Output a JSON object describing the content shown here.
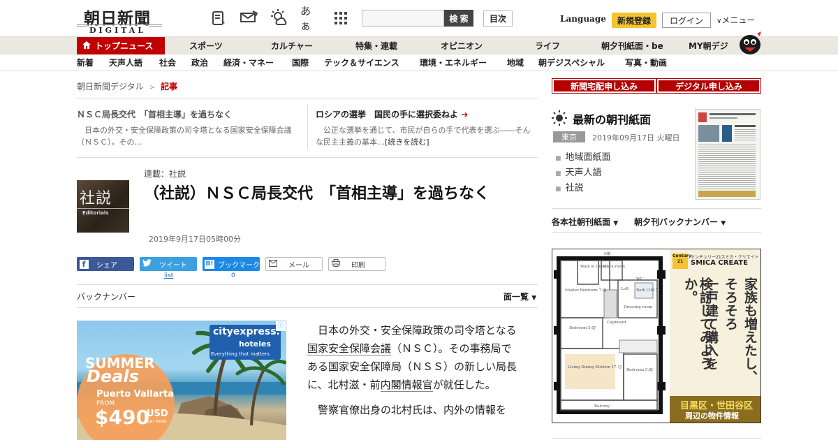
{
  "header": {
    "logo_kanji": "朝日新聞",
    "logo_sub": "DIGITAL",
    "icons": [
      "scrap-icon",
      "message-icon",
      "weather-icon",
      "font-size-icon",
      "grid-menu-icon"
    ],
    "font_size_label": "あぁ",
    "search_placeholder": "",
    "search_button": "検 索",
    "toc_button": "目次",
    "language": "Language",
    "signup": "新規登録",
    "login": "ログイン",
    "menu": "メニュー"
  },
  "nav_primary": [
    "トップニュース",
    "スポーツ",
    "カルチャー",
    "特集・連載",
    "オピニオン",
    "ライフ",
    "朝夕刊紙面・be",
    "MY朝デジ"
  ],
  "nav_secondary": [
    "新着",
    "天声人語",
    "社会",
    "政治",
    "経済・マネー",
    "国際",
    "テック＆サイエンス",
    "環境・エネルギー",
    "地域",
    "朝デジスペシャル",
    "写真・動画"
  ],
  "breadcrumb": {
    "home": "朝日新聞デジタル",
    "sep": ">",
    "current": "記事"
  },
  "teasers": [
    {
      "title": "ＮＳＣ局長交代　「首相主導」を過ちなく",
      "body": "日本の外交・安全保障政策の司令塔となる国家安全保障会議（ＮＳＣ）。その…"
    },
    {
      "title": "ロシアの選挙　国民の手に選択委ねよ",
      "body": "公正な選挙を通じて、市民が自らの手で代表を選ぶ――そんな民主主義の基本…",
      "more": "[続きを読む]"
    }
  ],
  "article": {
    "thumb_kanji": "社説",
    "thumb_en": "Editorials",
    "series": "連載：社説",
    "headline": "（社説）ＮＳＣ局長交代　「首相主導」を過ちなく",
    "date": "2019年9月17日05時00分",
    "share": {
      "facebook": "シェア",
      "twitter": "ツイート",
      "hatena": "ブックマーク",
      "mail": "メール",
      "print": "印刷",
      "twitter_count": "list",
      "hatena_count": "0"
    },
    "back_numbers": "バックナンバー",
    "page_list": "面一覧",
    "body": [
      [
        "日本の外交・安全保障政策の司令塔となる",
        "国家安全保障会議",
        "（ＮＳＣ）。その事務局である国家安全保障局（ＮＳＳ）の新しい局長に、北村滋・前",
        "内閣情報官",
        "が就任した。"
      ],
      [
        "警察官僚出身の北村氏は、内外の情報を"
      ]
    ]
  },
  "ad_left": {
    "brand": "cityexpress.",
    "brand_sub": "hoteles",
    "tagline": "Everything that matters",
    "headline1": "SUMMER",
    "headline2": "Deals",
    "city": "Puerto Vallarta",
    "from": "FROM",
    "price": "$490",
    "currency": "USD",
    "per": "per week"
  },
  "sidebar": {
    "btn_delivery": "新聞宅配申し込み",
    "btn_digital": "デジタル申し込み",
    "paper_title": "最新の朝刊紙面",
    "region": "東京",
    "paper_date": "2019年09月17日 火曜日",
    "links": [
      "地域面紙面",
      "天声人語",
      "社説"
    ],
    "dropdown_regional": "各本社朝刊紙面",
    "dropdown_backnumber": "朝夕刊バックナンバー"
  },
  "ad_right": {
    "brand": "センチュリー21スミカ・クリエイト",
    "brand_en": "SMICA CREATE",
    "logo": "Century 21",
    "copy_col1": "家族も増えたし、",
    "copy_col2": "そろそろ",
    "copy_col3": "一戸建て購入を",
    "copy_col4": "検討してみようか。",
    "area": "目黒区・世田谷区",
    "area_sub": "周辺の物件情報",
    "rooms": [
      "Walk in Closet",
      "Stock room",
      "Master Bedroom 7.0J",
      "Bath (1617)",
      "Dressing room",
      "Bedroom 5.0J",
      "Cupboard",
      "Living Dining Kitchen 17.1J",
      "Bedroom 5.8J",
      "Balcony",
      "WC",
      "MB",
      "Loft"
    ]
  },
  "colors": {
    "accent_red": "#c00000",
    "signup_yellow": "#f4c430",
    "nav_bg": "#ebe8e1"
  }
}
